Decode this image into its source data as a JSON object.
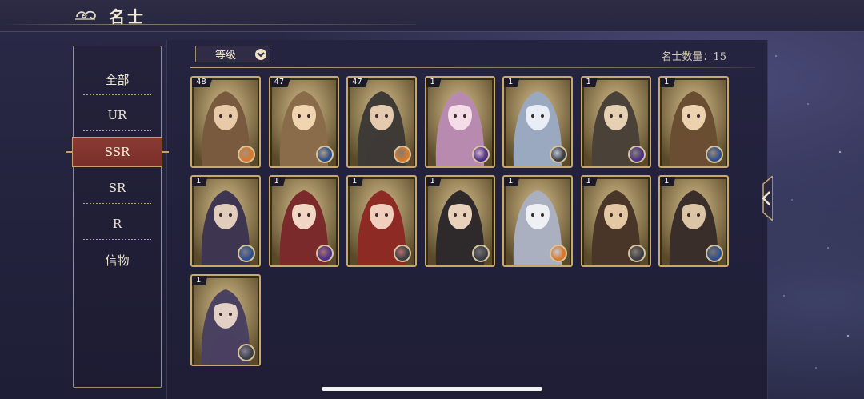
{
  "header": {
    "title": "名士"
  },
  "sidebar": {
    "items": [
      {
        "label": "全部",
        "active": false
      },
      {
        "label": "UR",
        "active": false
      },
      {
        "label": "SSR",
        "active": true
      },
      {
        "label": "SR",
        "active": false
      },
      {
        "label": "R",
        "active": false
      },
      {
        "label": "信物",
        "active": false
      }
    ]
  },
  "sort": {
    "label": "等级",
    "icon": "chevron-down-icon"
  },
  "count": {
    "text": "名士数量：15"
  },
  "cards": [
    {
      "level": "48",
      "badge": "sun"
    },
    {
      "level": "47",
      "badge": "water"
    },
    {
      "level": "47",
      "badge": "sun"
    },
    {
      "level": "1",
      "badge": "moon"
    },
    {
      "level": "1",
      "badge": "wind"
    },
    {
      "level": "1",
      "badge": "moon"
    },
    {
      "level": "1",
      "badge": "water"
    },
    {
      "level": "1",
      "badge": "water"
    },
    {
      "level": "1",
      "badge": "moon"
    },
    {
      "level": "1",
      "badge": "wind"
    },
    {
      "level": "1",
      "badge": "wind"
    },
    {
      "level": "1",
      "badge": "sun"
    },
    {
      "level": "1",
      "badge": "wind"
    },
    {
      "level": "1",
      "badge": "water"
    },
    {
      "level": "1",
      "badge": "wind"
    }
  ],
  "colors": {
    "accent_gold": "#c8a96a",
    "active_red": "#8a3a34",
    "sun": "#d9782a",
    "water": "#2c4f8c",
    "moon": "#4a2f86",
    "wind": "#3a3d45"
  }
}
